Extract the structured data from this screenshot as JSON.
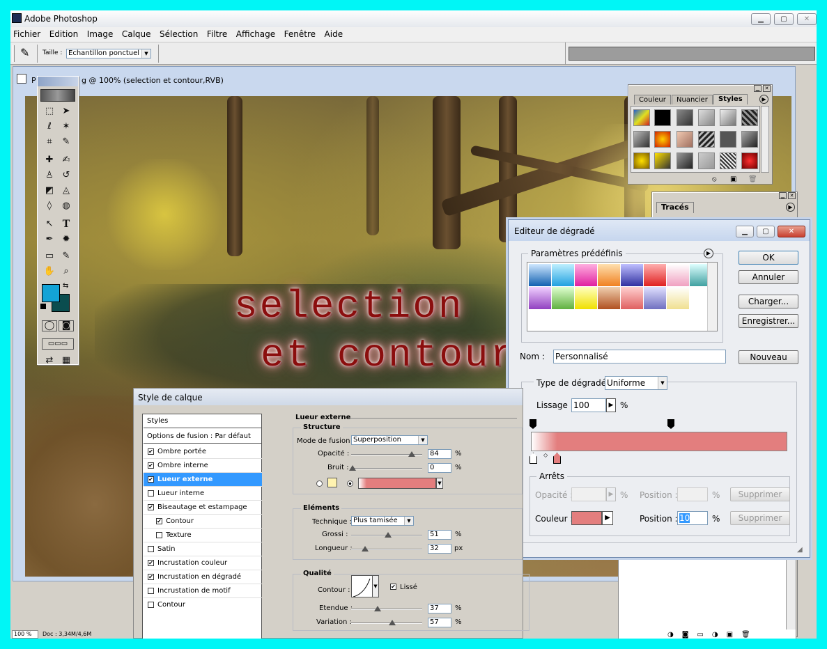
{
  "app": {
    "title": "Adobe Photoshop"
  },
  "menu": [
    "Fichier",
    "Edition",
    "Image",
    "Calque",
    "Sélection",
    "Filtre",
    "Affichage",
    "Fenêtre",
    "Aide"
  ],
  "options": {
    "size_label": "Taille :",
    "size_value": "Echantillon ponctuel"
  },
  "document": {
    "title_start": "P",
    "title_rest": "g @ 100% (selection  et contour,RVB)",
    "text_line1": "selection",
    "text_line2": "et contour",
    "zoom": "100 %",
    "doc_info": "Doc : 3,34M/4,6M"
  },
  "colors": {
    "foreground": "#13a3d6",
    "background": "#0a4d4f",
    "accent_gradient": "#e37e7e"
  },
  "styles_palette": {
    "tabs": [
      "Couleur",
      "Nuancier",
      "Styles"
    ],
    "active_tab": "Styles"
  },
  "paths_palette": {
    "tab": "Tracés"
  },
  "gradient_editor": {
    "title": "Editeur de dégradé",
    "presets_label": "Paramètres prédéfinis",
    "ok": "OK",
    "cancel": "Annuler",
    "load": "Charger...",
    "save": "Enregistrer...",
    "name_label": "Nom :",
    "name_value": "Personnalisé",
    "new": "Nouveau",
    "type_label": "Type de dégradé :",
    "type_value": "Uniforme",
    "smooth_label": "Lissage :",
    "smooth_value": "100",
    "percent": "%",
    "stops_label": "Arrêts",
    "opacity_label": "Opacité :",
    "position_label": "Position :",
    "delete": "Supprimer",
    "color_label": "Couleur :",
    "position_value": "10"
  },
  "layer_style": {
    "title": "Style de calque",
    "styles_header": "Styles",
    "blend_options": "Options de fusion : Par défaut",
    "items": [
      {
        "label": "Ombre portée",
        "checked": "✔"
      },
      {
        "label": "Ombre interne",
        "checked": "✔"
      },
      {
        "label": "Lueur externe",
        "checked": "✔"
      },
      {
        "label": "Lueur interne",
        "checked": ""
      },
      {
        "label": "Biseautage et estampage",
        "checked": "✔"
      },
      {
        "label": "Contour",
        "checked": "✔"
      },
      {
        "label": "Texture",
        "checked": ""
      },
      {
        "label": "Satin",
        "checked": ""
      },
      {
        "label": "Incrustation couleur",
        "checked": "✔"
      },
      {
        "label": "Incrustation en dégradé",
        "checked": "✔"
      },
      {
        "label": "Incrustation de motif",
        "checked": ""
      },
      {
        "label": "Contour",
        "checked": ""
      }
    ],
    "section_title": "Lueur externe",
    "structure": "Structure",
    "blend_mode_label": "Mode de fusion :",
    "blend_mode": "Superposition",
    "opacity_label": "Opacité :",
    "opacity": "84",
    "noise_label": "Bruit :",
    "noise": "0",
    "elements": "Eléments",
    "technique_label": "Technique :",
    "technique": "Plus tamisée",
    "spread_label": "Grossi :",
    "spread": "51",
    "size_label": "Longueur :",
    "size": "32",
    "px": "px",
    "quality": "Qualité",
    "contour_label": "Contour :",
    "antialias": "Lissé",
    "range_label": "Etendue :",
    "range": "37",
    "jitter_label": "Variation :",
    "jitter": "57",
    "percent": "%"
  }
}
